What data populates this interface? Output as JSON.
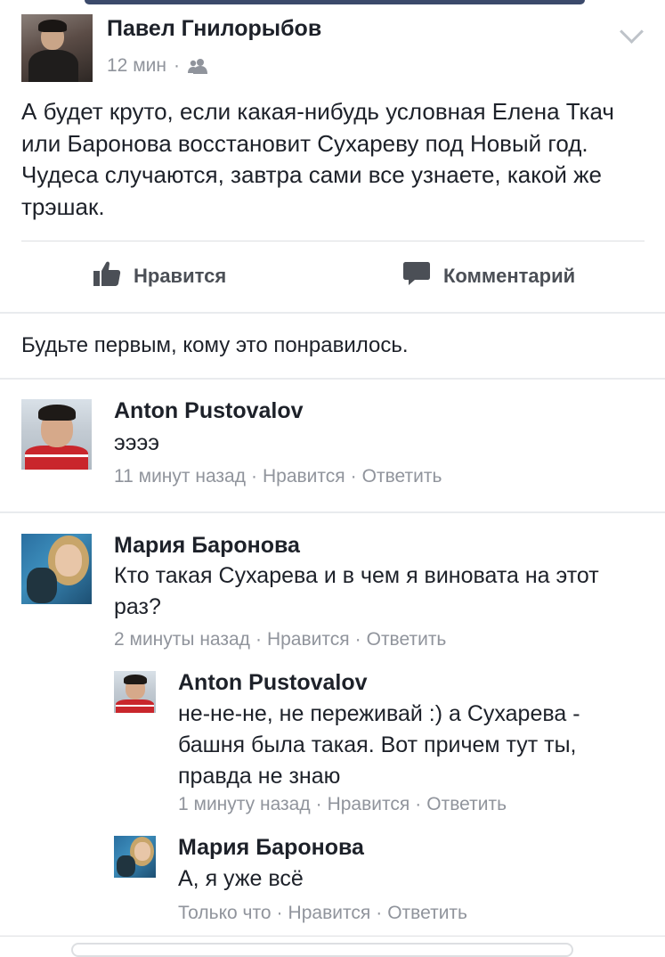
{
  "post": {
    "author": "Павел Гнилорыбов",
    "time": "12 мин",
    "meta_separator": "·",
    "audience_icon": "friends-icon",
    "text": "А будет круто, если какая-нибудь условная Елена Ткач или Баронова восстановит Сухареву под Новый год. Чудеса случаются, завтра сами все узнаете, какой же трэшак."
  },
  "actions": {
    "like_label": "Нравится",
    "like_icon": "thumbs-up-icon",
    "comment_label": "Комментарий",
    "comment_icon": "comment-bubble-icon"
  },
  "likes_summary": "Будьте первым, кому это понравилось.",
  "comments": [
    {
      "author": "Anton Pustovalov",
      "text": "ээээ",
      "time": "11 минут назад",
      "like": "Нравится",
      "reply": "Ответить"
    },
    {
      "author": "Мария Баронова",
      "text": "Кто такая Сухарева и в чем я виновата на этот раз?",
      "time": "2 минуты назад",
      "like": "Нравится",
      "reply": "Ответить",
      "replies": [
        {
          "author": "Anton Pustovalov",
          "text": "не-не-не, не переживай :) а Сухарева - башня была такая. Вот причем тут ты, правда не знаю",
          "time": "1 минуту назад",
          "like": "Нравится",
          "reply": "Ответить"
        },
        {
          "author": "Мария Баронова",
          "text": "А, я уже всё",
          "time": "Только что",
          "like": "Нравится",
          "reply": "Ответить"
        }
      ]
    }
  ],
  "colors": {
    "text": "#1d2129",
    "meta": "#90949c",
    "action": "#4b4f56",
    "divider": "#dddfe2"
  }
}
